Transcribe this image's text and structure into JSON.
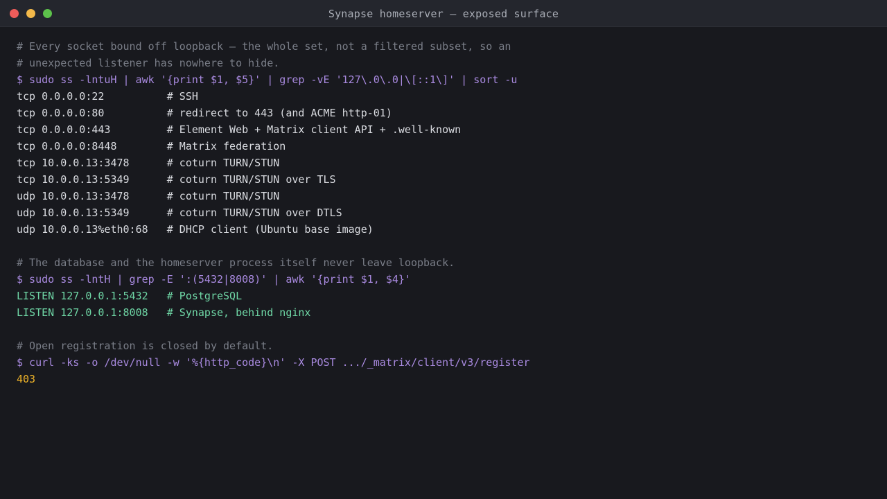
{
  "window": {
    "title": "Synapse homeserver — exposed surface",
    "controls": {
      "close": "#ee5c5a",
      "minimize": "#f3b94a",
      "maximize": "#5dc24b"
    }
  },
  "colors": {
    "background": "#18191e",
    "comment": "#7a7e88",
    "prompt": "#a98ae0",
    "output": "#d9dbe0",
    "success": "#6fd7a6",
    "status": "#f0b429"
  },
  "terminal": {
    "lines": [
      {
        "kind": "comment",
        "text": "# Every socket bound off loopback — the whole set, not a filtered subset, so an"
      },
      {
        "kind": "comment",
        "text": "# unexpected listener has nowhere to hide."
      },
      {
        "kind": "prompt",
        "text": "$ sudo ss -lntuH | awk '{print $1, $5}' | grep -vE '127\\.0\\.0|\\[::1\\]' | sort -u"
      },
      {
        "kind": "out",
        "text": "tcp 0.0.0.0:22          # SSH"
      },
      {
        "kind": "out",
        "text": "tcp 0.0.0.0:80          # redirect to 443 (and ACME http-01)"
      },
      {
        "kind": "out",
        "text": "tcp 0.0.0.0:443         # Element Web + Matrix client API + .well-known"
      },
      {
        "kind": "out",
        "text": "tcp 0.0.0.0:8448        # Matrix federation"
      },
      {
        "kind": "out",
        "text": "tcp 10.0.0.13:3478      # coturn TURN/STUN"
      },
      {
        "kind": "out",
        "text": "tcp 10.0.0.13:5349      # coturn TURN/STUN over TLS"
      },
      {
        "kind": "out",
        "text": "udp 10.0.0.13:3478      # coturn TURN/STUN"
      },
      {
        "kind": "out",
        "text": "udp 10.0.0.13:5349      # coturn TURN/STUN over DTLS"
      },
      {
        "kind": "out",
        "text": "udp 10.0.0.13%eth0:68   # DHCP client (Ubuntu base image)"
      },
      {
        "kind": "blank",
        "text": ""
      },
      {
        "kind": "comment",
        "text": "# The database and the homeserver process itself never leave loopback."
      },
      {
        "kind": "prompt",
        "text": "$ sudo ss -lntH | grep -E ':(5432|8008)' | awk '{print $1, $4}'"
      },
      {
        "kind": "ok",
        "text": "LISTEN 127.0.0.1:5432   # PostgreSQL"
      },
      {
        "kind": "ok",
        "text": "LISTEN 127.0.0.1:8008   # Synapse, behind nginx"
      },
      {
        "kind": "blank",
        "text": ""
      },
      {
        "kind": "comment",
        "text": "# Open registration is closed by default."
      },
      {
        "kind": "prompt",
        "text": "$ curl -ks -o /dev/null -w '%{http_code}\\n' -X POST .../_matrix/client/v3/register"
      },
      {
        "kind": "code",
        "text": "403"
      }
    ]
  }
}
